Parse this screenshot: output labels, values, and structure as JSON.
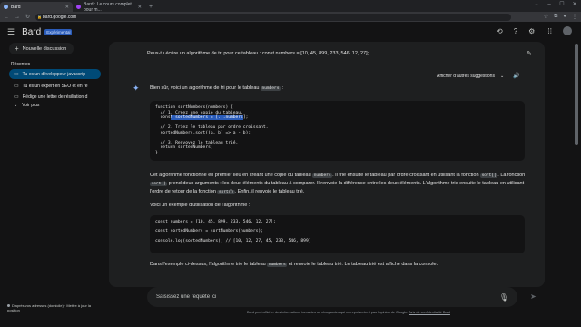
{
  "browser": {
    "tabs": [
      {
        "title": "Bard",
        "active": true,
        "icon": "bard-favicon"
      },
      {
        "title": "Bard : Le cours complet pour m...",
        "active": false,
        "icon": "course-favicon"
      }
    ],
    "url": "bard.google.com"
  },
  "app": {
    "name": "Bard",
    "badge": "Expérimental",
    "new_chat": "Nouvelle discussion",
    "recent_title": "Récentes",
    "recent": [
      "Tu es un développeur javascrip",
      "Tu es un expert en SEO et en ré",
      "Rédige une lettre de résiliation d"
    ],
    "more": "Voir plus",
    "location": "D'après vos adresses (domicile) · Mettre à jour la position"
  },
  "chat": {
    "prompt": "Peux-tu écrire un algorithme de tri pour ce tableau : const numbers = [10, 45, 899, 233, 546, 12, 27];",
    "other_suggestions": "Afficher d'autres suggestions",
    "intro_before": "Bien sûr, voici un algorithme de tri pour le tableau",
    "intro_code": "numbers",
    "intro_after": ":",
    "code1": {
      "l1": "function sortNumbers(numbers) {",
      "l2": "  // 1. Créez une copie du tableau.",
      "l3_pre": "  cons",
      "l3_sel": "t sortedNumbers = [...numbers",
      "l3_post": "];",
      "l4": "",
      "l5": "  // 2. Triez le tableau par ordre croissant.",
      "l6": "  sortedNumbers.sort((a, b) => a - b);",
      "l7": "",
      "l8": "  // 3. Renvoyez le tableau trié.",
      "l9": "  return sortedNumbers;",
      "l10": "}"
    },
    "explain": {
      "t1": "Cet algorithme fonctionne en premier lieu en créant une copie du tableau",
      "c1": "numbers",
      "t2": ". Il trie ensuite le tableau par ordre croissant en utilisant la fonction",
      "c2": "sort()",
      "t3": ". La fonction",
      "c3": "sort()",
      "t4": "prend deux arguments : les deux éléments du tableau à comparer. Il renvoie la différence entre les deux éléments. L'algorithme trie ensuite le tableau en utilisant l'ordre de retour de la fonction",
      "c4": "sort()",
      "t5": ". Enfin, il renvoie le tableau trié."
    },
    "example_intro": "Voici un exemple d'utilisation de l'algorithme :",
    "code2": {
      "l1": "const numbers = [10, 45, 899, 233, 546, 12, 27];",
      "l2": "",
      "l3": "const sortedNumbers = sortNumbers(numbers);",
      "l4": "",
      "l5": "console.log(sortedNumbers); // [10, 12, 27, 45, 233, 546, 899]"
    },
    "conclusion": {
      "t1": "Dans l'exemple ci-dessus, l'algorithme trie le tableau",
      "c1": "numbers",
      "t2": "et renvoie le tableau trié. Le tableau trié est affiché dans la console."
    }
  },
  "input": {
    "placeholder": "Saisissez une requête ici"
  },
  "disclaimer": {
    "text": "Bard peut afficher des informations inexactes ou choquantes qui ne représentent pas l'opinion de Google.",
    "link": "Avis de confidentialité Bard"
  },
  "colors": {
    "background": "#131314",
    "panel": "#1e1f20",
    "accent": "#8ab4f8",
    "active_item": "#004a77",
    "selection": "#2a5bb8"
  }
}
